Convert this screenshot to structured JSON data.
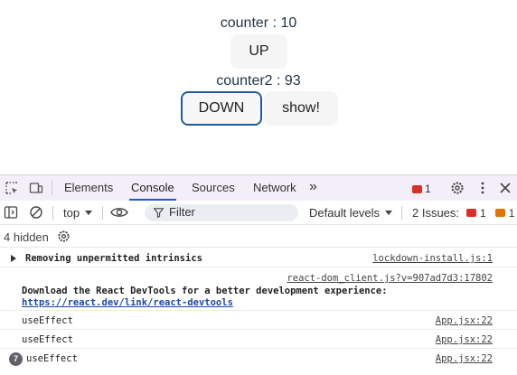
{
  "app": {
    "counter1": "counter : 10",
    "up_label": "UP",
    "counter2": "counter2 : 93",
    "down_label": "DOWN",
    "show_label": "show!"
  },
  "devtools": {
    "tabs": [
      "Elements",
      "Console",
      "Sources",
      "Network"
    ],
    "more_tabs": "»",
    "error_count": "1",
    "toolbar": {
      "context": "top",
      "filter_placeholder": "Filter",
      "levels": "Default levels",
      "issues_label": "2 Issues:",
      "issues_errors": "1",
      "issues_warnings": "1"
    },
    "hidden": "4 hidden",
    "logs": [
      {
        "text": "Removing unpermitted intrinsics",
        "source": "lockdown-install.js:1"
      },
      {
        "source": "react-dom_client.js?v=907ad7d3:17802",
        "line1": "Download the React DevTools for a better development experience:",
        "link": "https://react.dev/link/react-devtools"
      },
      {
        "text": "useEffect",
        "source": "App.jsx:22"
      },
      {
        "text": "useEffect",
        "source": "App.jsx:22"
      },
      {
        "text": "useEffect",
        "source": "App.jsx:22",
        "repeat": "7"
      }
    ]
  }
}
